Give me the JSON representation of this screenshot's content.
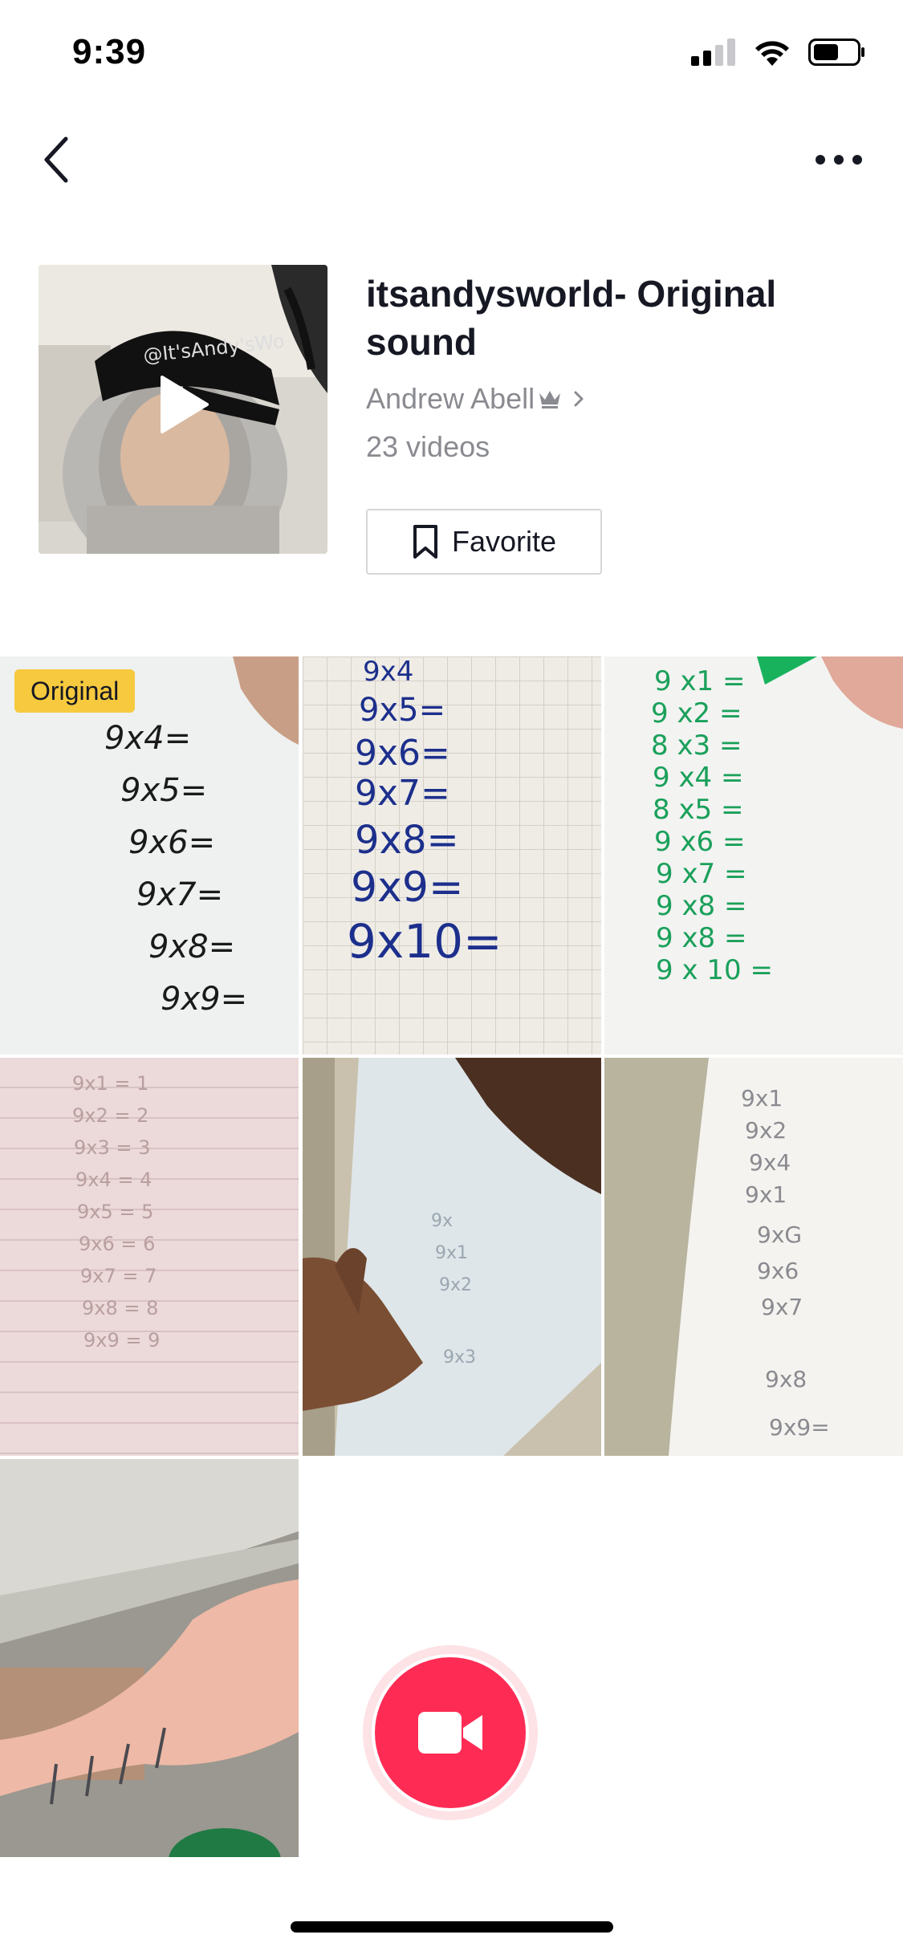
{
  "status_bar": {
    "time": "9:39",
    "icons": [
      "cellular-signal-icon",
      "wifi-icon",
      "battery-icon"
    ]
  },
  "nav": {
    "back_icon": "chevron-left-icon",
    "more_icon": "ellipsis-icon"
  },
  "sound": {
    "title": "itsandysworld- Original sound",
    "author": "Andrew Abell",
    "author_badge_icon": "crown-icon",
    "video_count": "23 videos",
    "favorite_label": "Favorite",
    "cover_overlay_text": "@It'sAndy'sWo"
  },
  "videos": [
    {
      "badge": "Original",
      "text": [
        "9x4=",
        "9x5=",
        "9x6=",
        "9x7=",
        "9x8=",
        "9x9="
      ],
      "ink": "#1a1a1a"
    },
    {
      "badge": "",
      "text": [
        "9x4",
        "9x5=",
        "9x6=",
        "9x7=",
        "9x8=",
        "9x9=",
        "9x10="
      ],
      "ink": "#1c2f8c"
    },
    {
      "badge": "",
      "text": [
        "9 x1 =",
        "9 x2 =",
        "8 x3 =",
        "9 x4 =",
        "8 x5 =",
        "9 x6 =",
        "9 x7 =",
        "9 x8 =",
        "9 x8 =",
        "9 x 10 ="
      ],
      "ink": "#1aa05a"
    },
    {
      "badge": "",
      "text": [
        "9x1 = 1",
        "9x2 = 2",
        "9x3 = 3",
        "9x4 = 4",
        "9x5 = 5",
        "9x6 = 6",
        "9x7 = 7",
        "9x8 = 8",
        "9x9 = 9"
      ],
      "ink": "#b99f9f"
    },
    {
      "badge": "",
      "text": [
        "9x",
        "9x1",
        "9x2",
        "9x3"
      ],
      "ink": "#9aa6b0"
    },
    {
      "badge": "",
      "text": [
        "9x1",
        "9x2",
        "9x4",
        "9x1",
        "9xG",
        "9x6",
        "9x7",
        "9x8",
        "9x9="
      ],
      "ink": "#8a8a90"
    },
    {
      "badge": "",
      "text": [],
      "ink": "#333333"
    }
  ],
  "record_button_icon": "video-camera-icon",
  "colors": {
    "accent": "#fe2c55",
    "badge": "#f6c93e",
    "muted_text": "#8a8b91"
  }
}
